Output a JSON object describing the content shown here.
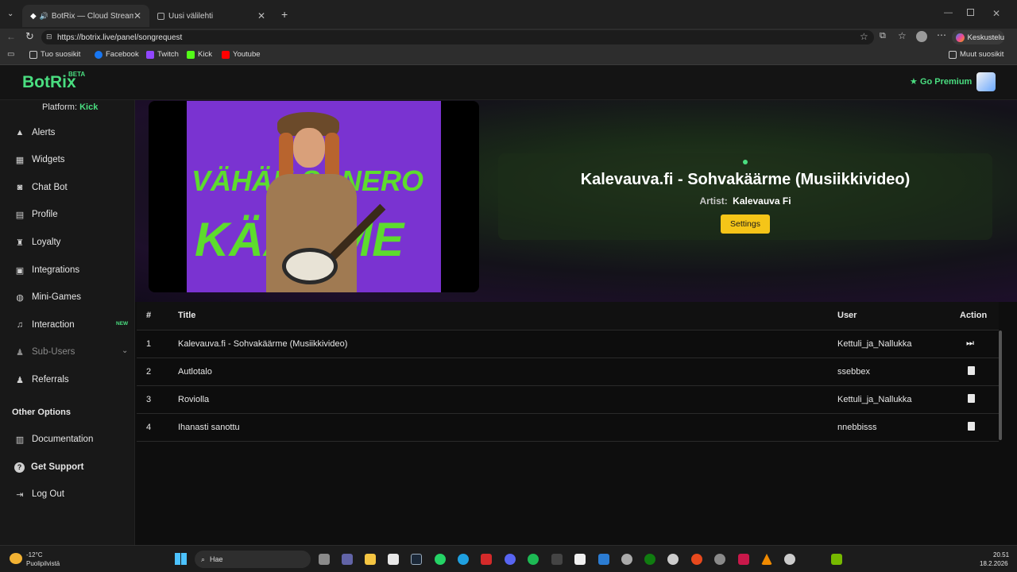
{
  "browser": {
    "tabs": [
      {
        "title": "BotRix — Cloud Streaming Bo",
        "active": true
      },
      {
        "title": "Uusi välilehti",
        "active": false
      }
    ],
    "url": "https://botrix.live/panel/songrequest",
    "profile_label": "Keskustelu",
    "bookmarks": [
      "Tuo suosikit",
      "Facebook",
      "Twitch",
      "Kick",
      "Youtube"
    ],
    "other_bookmarks": "Muut suosikit"
  },
  "app": {
    "logo": "BotRix",
    "beta": "BETA",
    "premium_label": "Go Premium",
    "platform_label": "Platform:",
    "platform_value": "Kick"
  },
  "sidebar": {
    "items": [
      {
        "label": "Alerts",
        "icon": "warning-icon"
      },
      {
        "label": "Widgets",
        "icon": "grid-icon"
      },
      {
        "label": "Chat Bot",
        "icon": "robot-icon"
      },
      {
        "label": "Profile",
        "icon": "id-card-icon"
      },
      {
        "label": "Loyalty",
        "icon": "trophy-icon"
      },
      {
        "label": "Integrations",
        "icon": "plug-icon"
      },
      {
        "label": "Mini-Games",
        "icon": "gamepad-icon"
      },
      {
        "label": "Interaction",
        "icon": "music-icon",
        "badge": "NEW"
      },
      {
        "label": "Sub-Users",
        "icon": "users-icon"
      },
      {
        "label": "Referrals",
        "icon": "users-icon"
      }
    ],
    "other_heading": "Other Options",
    "other_items": [
      {
        "label": "Documentation",
        "icon": "book-icon"
      },
      {
        "label": "Get Support",
        "icon": "question-icon"
      },
      {
        "label": "Log Out",
        "icon": "logout-icon"
      }
    ]
  },
  "now_playing": {
    "title": "Kalevauva.fi - Sohvakäärme (Musiikkivideo)",
    "artist_label": "Artist:",
    "artist": "Kalevauva Fi",
    "settings_label": "Settings",
    "thumbnail_text_top": "VÄHÄN SANERO",
    "thumbnail_text_bottom": "KÄÄRME"
  },
  "queue": {
    "headers": {
      "num": "#",
      "title": "Title",
      "user": "User",
      "action": "Action"
    },
    "rows": [
      {
        "num": "1",
        "title": "Kalevauva.fi - Sohvakäärme (Musiikkivideo)",
        "user": "Kettuli_ja_Nallukka",
        "action": "skip"
      },
      {
        "num": "2",
        "title": "Autlotalo",
        "user": "ssebbex",
        "action": "delete"
      },
      {
        "num": "3",
        "title": "Roviolla",
        "user": "Kettuli_ja_Nallukka",
        "action": "delete"
      },
      {
        "num": "4",
        "title": "Ihanasti sanottu",
        "user": "nnebbisss",
        "action": "delete"
      }
    ]
  },
  "taskbar": {
    "weather_temp": "-12°C",
    "weather_desc": "Puolipilvistä",
    "search_placeholder": "Hae",
    "time": "20.51",
    "date": "18.2.2026"
  },
  "colors": {
    "accent": "#4ade80",
    "premium": "#4ade80",
    "settings_button": "#f5c518",
    "thumbnail_bg": "#7a33d1",
    "thumbnail_text": "#5ddc2d"
  }
}
